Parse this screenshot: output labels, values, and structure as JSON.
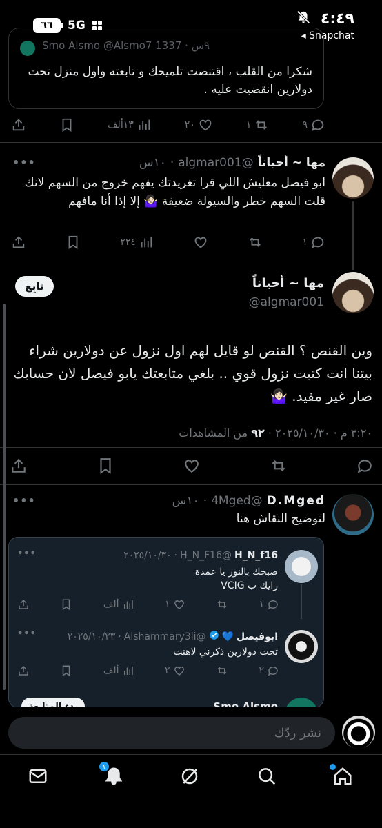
{
  "status_bar": {
    "time": "٤:٤٩",
    "app": "Snapchat",
    "battery": "٦٦",
    "network": "5G"
  },
  "top_quote": {
    "partial_header": "Smo Alsmo  @Alsmo7 1337 · ٩س",
    "text": "شكرا من القلب ، اقتنصت تلميحك و تابعته واول منزل تحت دولارين انقضيت عليه ."
  },
  "top_actions": {
    "replies": "٩",
    "retweets": "١",
    "likes": "٢٠",
    "views": "١٣ألف"
  },
  "reply1": {
    "name": "مها ~ أحياناً",
    "handle": "@algmar001",
    "time": "١٠س",
    "text": "ابو فيصل معليش اللي قرا تغريدتك يفهم خروج من السهم لانك قلت السهم خطر والسيولة ضعيفة 🤷🏻‍♀️ إلا إذا أنا مافهم",
    "actions": {
      "replies": "١",
      "retweets": "",
      "likes": "",
      "views": "٢٢٤"
    }
  },
  "main_tweet": {
    "name": "مها ~ أحياناً",
    "handle": "@algmar001",
    "follow_label": "تابِع",
    "text": "وين القنص ؟ القنص لو قايل لهم اول نزول عن دولارين شراء بيتنا انت كتبت نزول قوي .. بلغي متابعتك يابو فيصل لان حسابك صار غير مفيد. 🤷🏻‍♀️",
    "datetime": "٣:٢٠ م · ٢٠٢٥/١٠/٣٠ ·",
    "views_count": "٩٢",
    "views_label": "من المشاهدات"
  },
  "reply2": {
    "name": "D.Mged",
    "handle": "@4Mged",
    "time": "١٠س",
    "text": "لتوضيح النقاش هنا"
  },
  "embed": {
    "t1": {
      "name": "H_N_f16",
      "handle": "@H_N_F16",
      "date": "٢٠٢٥/١٠/٣٠",
      "text1": "صبحك بالنور يا عمدة",
      "text2": "رايك ب VCIG",
      "actions": {
        "replies": "١",
        "likes": "١",
        "views": "ألف"
      }
    },
    "t2": {
      "name": "ابوفيصل",
      "handle": "@Alshammary3li",
      "date": "٢٠٢٥/١٠/٢٣",
      "text": "تحت دولارين ذكرني لاهنت",
      "actions": {
        "replies": "٢",
        "likes": "٢",
        "views": "ألف"
      }
    },
    "t3": {
      "name": "Smo Alsmo",
      "button": "بدء المتابعة"
    }
  },
  "composer": {
    "placeholder": "نشر ردّك"
  },
  "nav": {
    "notifications_badge": "١"
  },
  "colors": {
    "background": "#000000",
    "text": "#e7e9ea",
    "muted": "#71767b",
    "accent": "#1d9bf0",
    "embed_bg": "#15202b"
  }
}
